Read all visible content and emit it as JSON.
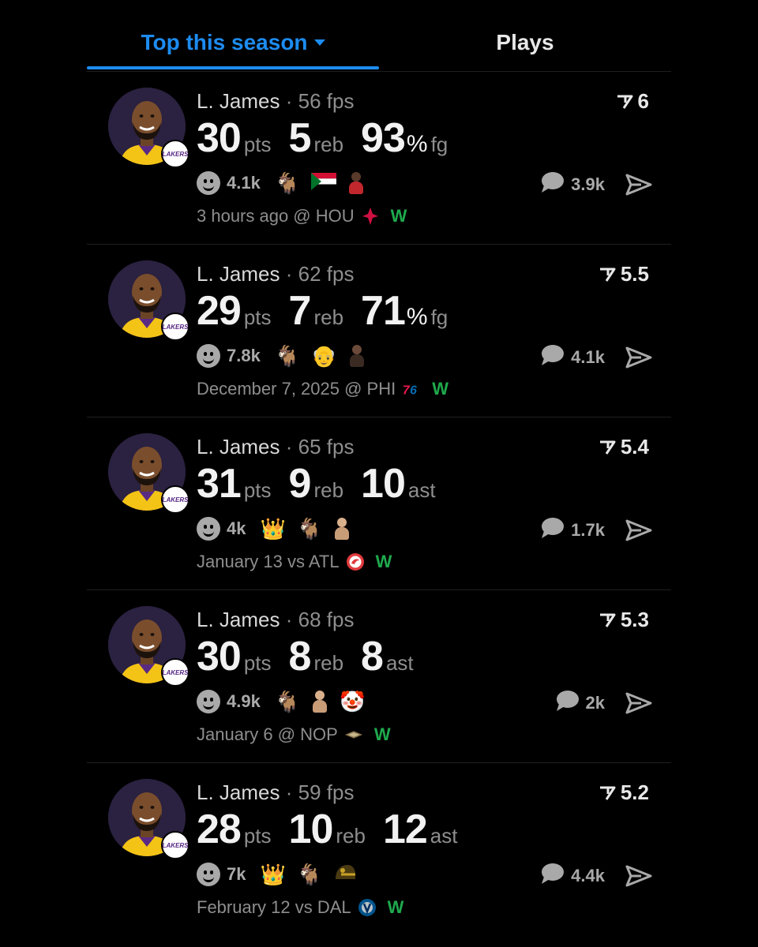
{
  "tabs": {
    "active_label": "Top this season",
    "other_label": "Plays"
  },
  "colors": {
    "accent": "#1d8cf0",
    "win": "#1fa94d",
    "muted": "#8e8e8e"
  },
  "cards": [
    {
      "player": "L. James",
      "fps": "· 56 fps",
      "score": "6",
      "stats": [
        {
          "num": "30",
          "pct": "",
          "unit": "pts"
        },
        {
          "num": "5",
          "pct": "",
          "unit": "reb"
        },
        {
          "num": "93",
          "pct": "%",
          "unit": "fg"
        }
      ],
      "reactions": "4.1k",
      "emojis": [
        "goat-icon",
        "sudan-flag-icon",
        "figure-red-icon"
      ],
      "comments": "3.9k",
      "meta": "3 hours ago @ HOU",
      "opponent_logo": "rockets-logo",
      "result": "W"
    },
    {
      "player": "L. James",
      "fps": "· 62 fps",
      "score": "5.5",
      "stats": [
        {
          "num": "29",
          "pct": "",
          "unit": "pts"
        },
        {
          "num": "7",
          "pct": "",
          "unit": "reb"
        },
        {
          "num": "71",
          "pct": "%",
          "unit": "fg"
        }
      ],
      "reactions": "7.8k",
      "emojis": [
        "goat-icon",
        "bald-face-icon",
        "figure-dark-icon"
      ],
      "comments": "4.1k",
      "meta": "December 7, 2025 @ PHI",
      "opponent_logo": "76ers-logo",
      "result": "W"
    },
    {
      "player": "L. James",
      "fps": "· 65 fps",
      "score": "5.4",
      "stats": [
        {
          "num": "31",
          "pct": "",
          "unit": "pts"
        },
        {
          "num": "9",
          "pct": "",
          "unit": "reb"
        },
        {
          "num": "10",
          "pct": "",
          "unit": "ast"
        }
      ],
      "reactions": "4k",
      "emojis": [
        "crown-icon",
        "goat-icon",
        "figure-tan-icon"
      ],
      "comments": "1.7k",
      "meta": "January 13 vs ATL",
      "opponent_logo": "hawks-logo",
      "result": "W"
    },
    {
      "player": "L. James",
      "fps": "· 68 fps",
      "score": "5.3",
      "stats": [
        {
          "num": "30",
          "pct": "",
          "unit": "pts"
        },
        {
          "num": "8",
          "pct": "",
          "unit": "reb"
        },
        {
          "num": "8",
          "pct": "",
          "unit": "ast"
        }
      ],
      "reactions": "4.9k",
      "emojis": [
        "goat-icon",
        "figure-tan-icon",
        "clown-icon"
      ],
      "comments": "2k",
      "meta": "January 6 @ NOP",
      "opponent_logo": "pelicans-logo",
      "result": "W"
    },
    {
      "player": "L. James",
      "fps": "· 59 fps",
      "score": "5.2",
      "stats": [
        {
          "num": "28",
          "pct": "",
          "unit": "pts"
        },
        {
          "num": "10",
          "pct": "",
          "unit": "reb"
        },
        {
          "num": "12",
          "pct": "",
          "unit": "ast"
        }
      ],
      "reactions": "7k",
      "emojis": [
        "crown-icon",
        "goat-icon",
        "helmet-icon"
      ],
      "comments": "4.4k",
      "meta": "February 12 vs DAL",
      "opponent_logo": "mavericks-logo",
      "result": "W"
    }
  ]
}
